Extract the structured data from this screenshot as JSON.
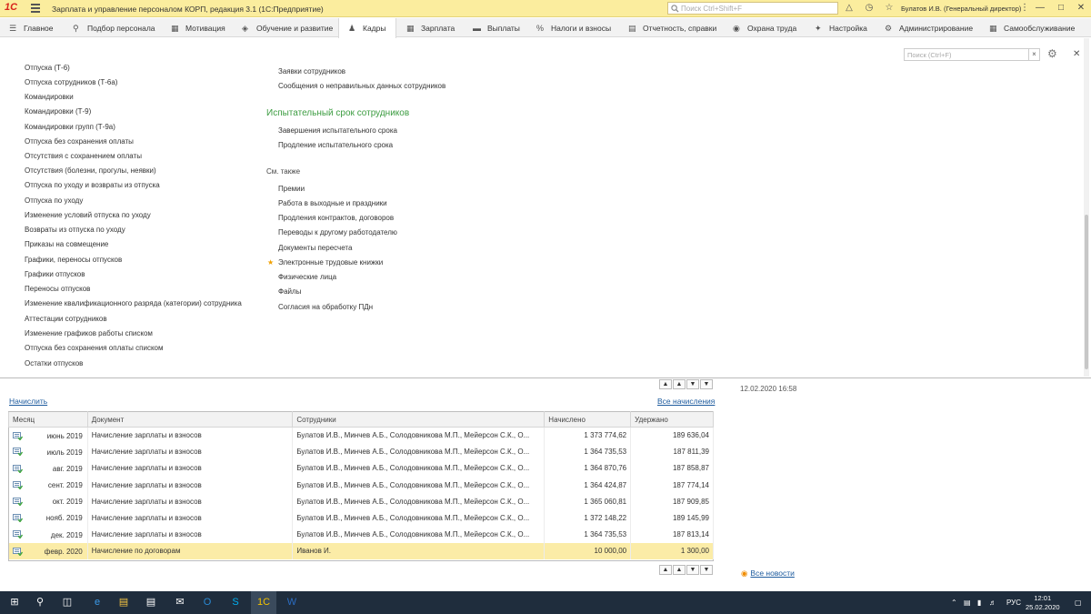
{
  "window": {
    "title": "Зарплата и управление персоналом КОРП, редакция 3.1  (1С:Предприятие)",
    "search_placeholder": "Поиск Ctrl+Shift+F",
    "user": "Булатов И.В. (Генеральный директор)"
  },
  "menu": [
    {
      "label": "Главное",
      "icon": "menu-icon"
    },
    {
      "label": "Подбор персонала",
      "icon": "search-person-icon"
    },
    {
      "label": "Мотивация",
      "icon": "chart-icon"
    },
    {
      "label": "Обучение и развитие",
      "icon": "education-icon"
    },
    {
      "label": "Кадры",
      "icon": "people-icon",
      "active": true
    },
    {
      "label": "Зарплата",
      "icon": "calculator-icon"
    },
    {
      "label": "Выплаты",
      "icon": "wallet-icon"
    },
    {
      "label": "Налоги и взносы",
      "icon": "percent-icon"
    },
    {
      "label": "Отчетность, справки",
      "icon": "report-icon"
    },
    {
      "label": "Охрана труда",
      "icon": "helmet-icon"
    },
    {
      "label": "Настройка",
      "icon": "wrench-icon"
    },
    {
      "label": "Администрирование",
      "icon": "gear-icon"
    },
    {
      "label": "Самообслуживание",
      "icon": "self-service-icon"
    }
  ],
  "panel": {
    "search_placeholder": "Поиск (Ctrl+F)",
    "left_links": [
      "Отпуска (Т-6)",
      "Отпуска сотрудников (Т-6а)",
      "Командировки",
      "Командировки (Т-9)",
      "Командировки групп (Т-9а)",
      "Отпуска без сохранения оплаты",
      "Отсутствия с сохранением оплаты",
      "Отсутствия (болезни, прогулы, неявки)",
      "Отпуска по уходу и возвраты из отпуска",
      "Отпуска по уходу",
      "Изменение условий отпуска по уходу",
      "Возвраты из отпуска по уходу",
      "Приказы на совмещение",
      "Графики, переносы отпусков",
      "Графики отпусков",
      "Переносы отпусков",
      "Изменение квалификационного разряда (категории) сотрудника",
      "Аттестации сотрудников",
      "Изменение графиков работы списком",
      "Отпуска без сохранения оплаты списком",
      "Остатки отпусков"
    ],
    "right_top_links": [
      "Заявки сотрудников",
      "Сообщения о неправильных данных сотрудников"
    ],
    "probation_title": "Испытательный срок сотрудников",
    "probation_links": [
      "Завершения испытательного срока",
      "Продление испытательного срока"
    ],
    "see_also_title": "См. также",
    "see_also_links": [
      "Премии",
      "Работа в выходные и праздники",
      "Продления контрактов, договоров",
      "Переводы к другому работодателю",
      "Документы пересчета",
      "Электронные трудовые книжки",
      "Физические лица",
      "Файлы",
      "Согласия на обработку ПДн"
    ]
  },
  "accruals": {
    "accrue_link": "Начислить",
    "all_link": "Все начисления",
    "columns": [
      "Месяц",
      "Документ",
      "Сотрудники",
      "Начислено",
      "Удержано"
    ],
    "rows": [
      {
        "month": "июнь 2019",
        "doc": "Начисление зарплаты и взносов",
        "emp": "Булатов И.В., Минчев А.Б., Солодовникова М.П., Мейерсон С.К., О...",
        "acc": "1 373 774,62",
        "ded": "189 636,04"
      },
      {
        "month": "июль 2019",
        "doc": "Начисление зарплаты и взносов",
        "emp": "Булатов И.В., Минчев А.Б., Солодовникова М.П., Мейерсон С.К., О...",
        "acc": "1 364 735,53",
        "ded": "187 811,39"
      },
      {
        "month": "авг. 2019",
        "doc": "Начисление зарплаты и взносов",
        "emp": "Булатов И.В., Минчев А.Б., Солодовникова М.П., Мейерсон С.К., О...",
        "acc": "1 364 870,76",
        "ded": "187 858,87"
      },
      {
        "month": "сент. 2019",
        "doc": "Начисление зарплаты и взносов",
        "emp": "Булатов И.В., Минчев А.Б., Солодовникова М.П., Мейерсон С.К., О...",
        "acc": "1 364 424,87",
        "ded": "187 774,14"
      },
      {
        "month": "окт. 2019",
        "doc": "Начисление зарплаты и взносов",
        "emp": "Булатов И.В., Минчев А.Б., Солодовникова М.П., Мейерсон С.К., О...",
        "acc": "1 365 060,81",
        "ded": "187 909,85"
      },
      {
        "month": "нояб. 2019",
        "doc": "Начисление зарплаты и взносов",
        "emp": "Булатов И.В., Минчев А.Б., Солодовникова М.П., Мейерсон С.К., О...",
        "acc": "1 372 148,22",
        "ded": "189 145,99"
      },
      {
        "month": "дек. 2019",
        "doc": "Начисление зарплаты и взносов",
        "emp": "Булатов И.В., Минчев А.Б., Солодовникова М.П., Мейерсон С.К., О...",
        "acc": "1 364 735,53",
        "ded": "187 813,14"
      },
      {
        "month": "февр. 2020",
        "doc": "Начисление по договорам",
        "emp": "Иванов И.",
        "acc": "10 000,00",
        "ded": "1 300,00",
        "selected": true
      }
    ]
  },
  "news": {
    "date": "12.02.2020 16:58",
    "all_news": "Все новости"
  },
  "taskbar": {
    "lang": "РУС",
    "time": "12:01",
    "date": "25.02.2020"
  },
  "colors": {
    "titlebar": "#fbed9e",
    "group_title": "#3c9c41",
    "link_blue": "#1d5b9e",
    "selected_row": "#fbeca7",
    "taskbar": "#1f2d3d"
  }
}
